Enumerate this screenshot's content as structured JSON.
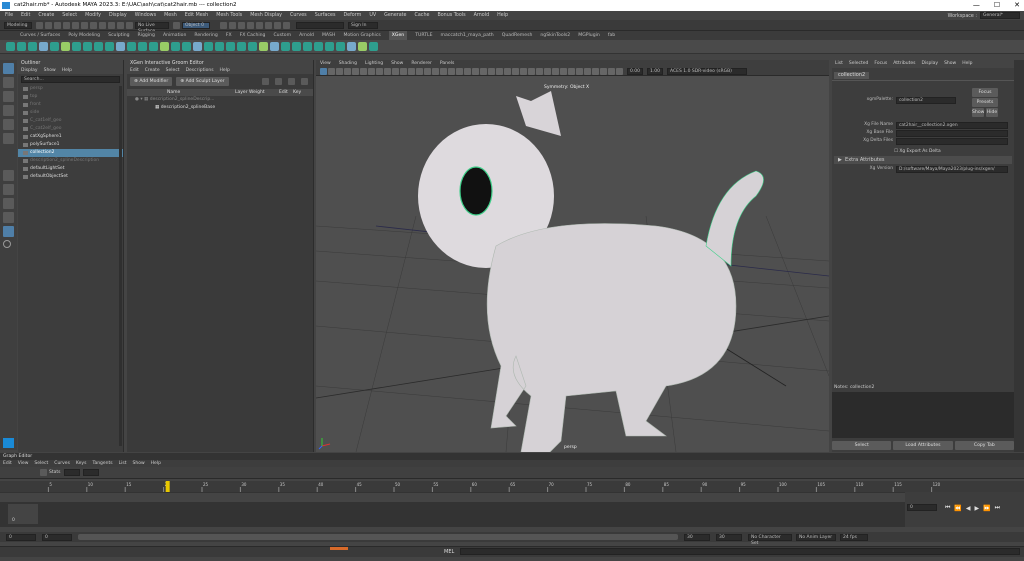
{
  "window": {
    "title": "cat2hair.mb* - Autodesk MAYA 2023.3: E:\\UAC\\ash\\cat\\cat2hair.mb --- collection2",
    "controls": [
      "—",
      "☐",
      "✕"
    ]
  },
  "menubar": {
    "items": [
      "File",
      "Edit",
      "Create",
      "Select",
      "Modify",
      "Display",
      "Windows",
      "Mesh",
      "Edit Mesh",
      "Mesh Tools",
      "Mesh Display",
      "Curves",
      "Surfaces",
      "Deform",
      "UV",
      "Generate",
      "Cache",
      "Bonus Tools",
      "Arnold",
      "Help"
    ],
    "workspace_label": "Workspace :",
    "workspace_value": "General*"
  },
  "statusline": {
    "mode": "Modeling",
    "live_surface": "No Live Surface",
    "object": "Object 0",
    "signin": "Sign In"
  },
  "shelf_tabs": [
    "Curves / Surfaces",
    "Poly Modeling",
    "Sculpting",
    "Rigging",
    "Animation",
    "Rendering",
    "FX",
    "FX Caching",
    "Custom",
    "Arnold",
    "MASH",
    "Motion Graphics",
    "XGen",
    "TURTLE",
    "maccatch1_maya_path",
    "QuadRemesh",
    "ngSkinTools2",
    "MGPlugin",
    "fab"
  ],
  "shelf_active": "XGen",
  "outliner": {
    "title": "Outliner",
    "menu": [
      "Display",
      "Show",
      "Help"
    ],
    "search": "Search...",
    "items": [
      {
        "label": "persp",
        "state": "dim"
      },
      {
        "label": "top",
        "state": "dim"
      },
      {
        "label": "front",
        "state": "dim"
      },
      {
        "label": "side",
        "state": "dim"
      },
      {
        "label": "C_cat1elf_geo",
        "state": "dim"
      },
      {
        "label": "C_cat2elf_geo",
        "state": "dim"
      },
      {
        "label": "catXgSphere1",
        "state": "normal"
      },
      {
        "label": "polySurface1",
        "state": "normal"
      },
      {
        "label": "collection2",
        "state": "selected"
      },
      {
        "label": "description2_splineDescription",
        "state": "dim"
      },
      {
        "label": "defaultLightSet",
        "state": "normal"
      },
      {
        "label": "defaultObjectSet",
        "state": "normal"
      }
    ]
  },
  "xgen": {
    "title": "XGen Interactive Groom Editor",
    "menu": [
      "Edit",
      "Create",
      "Select",
      "Descriptions",
      "Help"
    ],
    "add_modifier": "Add Modifier",
    "add_sculpt": "Add Sculpt Layer",
    "columns": [
      "Name",
      "Layer Weight",
      "Edit",
      "Key"
    ],
    "rows": [
      "description2_splineDescrip...",
      "description2_splineBase"
    ]
  },
  "viewport": {
    "menu": [
      "View",
      "Shading",
      "Lighting",
      "Show",
      "Renderer",
      "Panels"
    ],
    "hud_label": "Symmetry: Object X",
    "camera": "persp",
    "num1": "0.00",
    "num2": "1.00",
    "colorspace": "ACES 1.0 SDR-video (sRGB)"
  },
  "attr": {
    "menu": [
      "List",
      "Selected",
      "Focus",
      "Attributes",
      "Display",
      "Show",
      "Help"
    ],
    "tab": "collection2",
    "node_label": "xgmPalette:",
    "node_value": "collection2",
    "focus": "Focus",
    "presets": "Presets",
    "show": "Show",
    "hide": "Hide",
    "rows": [
      {
        "label": "Xg File Name",
        "value": "cat2hair__collection2.xgen"
      },
      {
        "label": "Xg Base File",
        "value": ""
      },
      {
        "label": "Xg Delta Files",
        "value": ""
      }
    ],
    "export_delta": "Xg Export As Delta",
    "extra": "Extra Attributes",
    "version_label": "Xg Version",
    "version_value": "D:/software/Maya/Maya2023/plug-ins/xgen/",
    "notes": "Notes:  collection2",
    "buttons": [
      "Select",
      "Load Attributes",
      "Copy Tab"
    ]
  },
  "graph": {
    "title": "Graph Editor",
    "menu": [
      "Edit",
      "View",
      "Select",
      "Curves",
      "Keys",
      "Tangents",
      "List",
      "Show",
      "Help"
    ],
    "stats": "Stats",
    "search": "Search"
  },
  "timeline": {
    "ticks": [
      "5",
      "10",
      "15",
      "20",
      "25",
      "30",
      "35",
      "40",
      "45",
      "50",
      "55",
      "60",
      "65",
      "70",
      "75",
      "80",
      "85",
      "90",
      "95",
      "100",
      "105",
      "110",
      "115",
      "120"
    ],
    "current": "1",
    "current_frame": "0",
    "start": "0",
    "end": "0"
  },
  "range": {
    "start": "0",
    "inner_start": "0",
    "inner_end": "30",
    "end": "30",
    "char_set": "No Character Set",
    "anim_layer": "No Anim Layer",
    "fps": "24 fps"
  },
  "commandline": {
    "lang": "MEL"
  }
}
